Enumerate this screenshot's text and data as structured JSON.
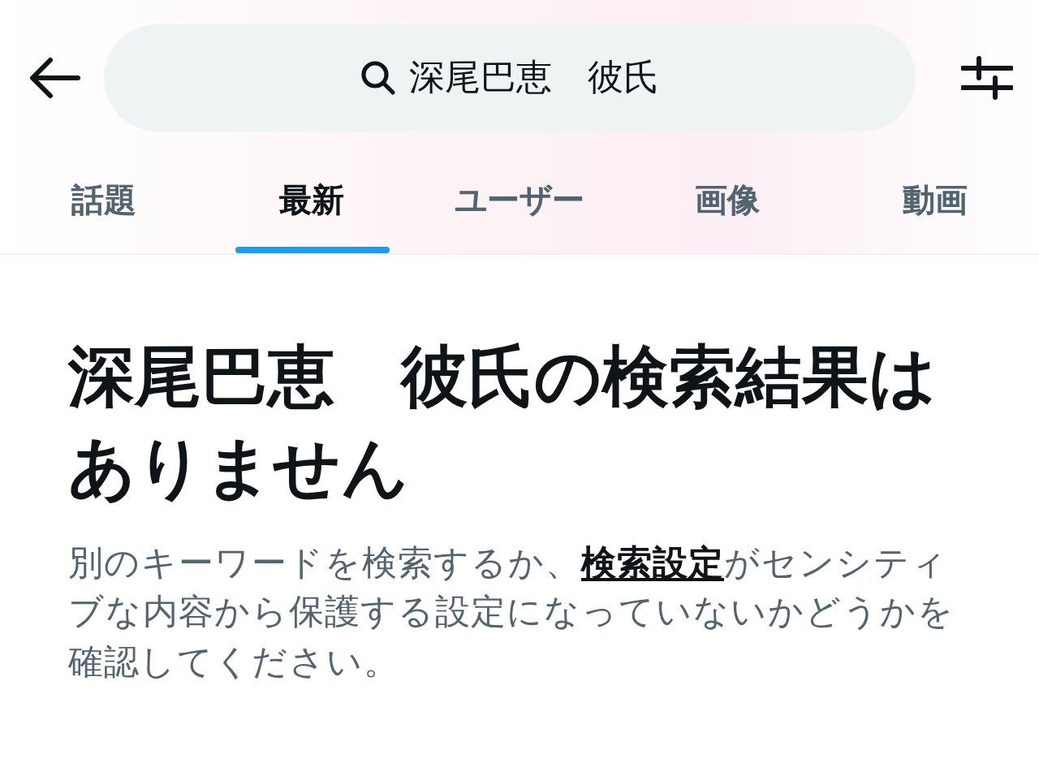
{
  "search": {
    "value": "深尾巴恵　彼氏"
  },
  "tabs": [
    {
      "label": "話題",
      "selected": false
    },
    {
      "label": "最新",
      "selected": true
    },
    {
      "label": "ユーザー",
      "selected": false
    },
    {
      "label": "画像",
      "selected": false
    },
    {
      "label": "動画",
      "selected": false
    }
  ],
  "empty_state": {
    "title": "深尾巴恵　彼氏の検索結果はありません",
    "text_before": "別のキーワードを検索するか、",
    "link": "検索設定",
    "text_after": "がセンシティブな内容から保護する設定になっていないかどうかを確認してください。"
  }
}
